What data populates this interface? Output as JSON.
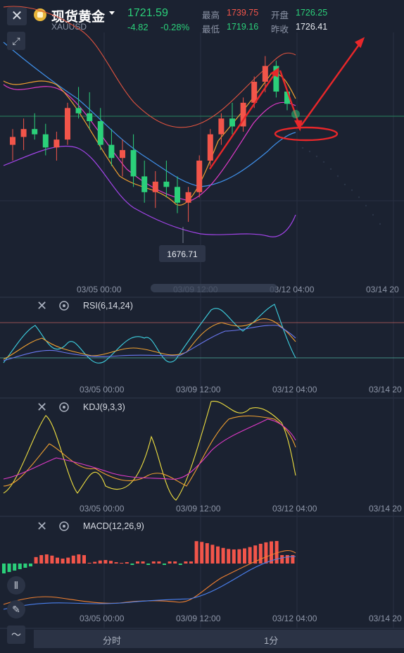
{
  "header": {
    "title": "现货黄金",
    "symbol": "XAUUSD",
    "price": "1721.59",
    "change": "-4.82",
    "change_pct": "-0.28%",
    "high_label": "最高",
    "high_value": "1739.75",
    "open_label": "开盘",
    "open_value": "1726.25",
    "low_label": "最低",
    "low_value": "1719.16",
    "prev_close_label": "昨收",
    "prev_close_value": "1726.41"
  },
  "main_chart": {
    "low_marker": "1676.71",
    "x_labels": [
      "03/05 00:00",
      "03/09 12:00",
      "03/12 04:00",
      "03/14 20"
    ]
  },
  "rsi_panel": {
    "label": "RSI(6,14,24)",
    "x_labels": [
      "03/05 00:00",
      "03/09 12:00",
      "03/12 04:00",
      "03/14 20"
    ]
  },
  "kdj_panel": {
    "label": "KDJ(9,3,3)",
    "x_labels": [
      "03/05 00:00",
      "03/09 12:00",
      "03/12 04:00",
      "03/14 20"
    ]
  },
  "macd_panel": {
    "label": "MACD(12,26,9)",
    "x_labels": [
      "03/05 00:00",
      "03/09 12:00",
      "03/12 04:00",
      "03/14 20"
    ]
  },
  "bottom_tabs": [
    "分时",
    "1分"
  ],
  "colors": {
    "up": "#f2554a",
    "down": "#2bd07a",
    "bg": "#1b2231"
  },
  "icons": [
    "close-icon",
    "gold-logo-icon",
    "dropdown-caret-icon",
    "expand-icon",
    "settings-icon",
    "indicator-icon",
    "draw-icon",
    "line-tool-icon"
  ],
  "chart_data": {
    "type": "candlestick",
    "ohlc": [
      [
        1706,
        1712,
        1700,
        1709
      ],
      [
        1709,
        1716,
        1704,
        1712
      ],
      [
        1712,
        1718,
        1708,
        1710
      ],
      [
        1710,
        1714,
        1702,
        1705
      ],
      [
        1705,
        1711,
        1700,
        1708
      ],
      [
        1708,
        1722,
        1706,
        1720
      ],
      [
        1720,
        1728,
        1716,
        1718
      ],
      [
        1718,
        1726,
        1712,
        1715
      ],
      [
        1715,
        1720,
        1704,
        1706
      ],
      [
        1706,
        1712,
        1698,
        1701
      ],
      [
        1701,
        1708,
        1694,
        1704
      ],
      [
        1704,
        1710,
        1690,
        1694
      ],
      [
        1694,
        1700,
        1684,
        1688
      ],
      [
        1688,
        1696,
        1682,
        1692
      ],
      [
        1692,
        1700,
        1686,
        1690
      ],
      [
        1690,
        1694,
        1680,
        1684
      ],
      [
        1684,
        1690,
        1676.71,
        1688
      ],
      [
        1688,
        1702,
        1686,
        1700
      ],
      [
        1700,
        1712,
        1698,
        1710
      ],
      [
        1710,
        1718,
        1706,
        1716
      ],
      [
        1716,
        1722,
        1710,
        1713
      ],
      [
        1713,
        1724,
        1711,
        1722
      ],
      [
        1722,
        1732,
        1720,
        1730
      ],
      [
        1730,
        1739.75,
        1726,
        1736
      ],
      [
        1736,
        1738,
        1724,
        1726.25
      ],
      [
        1726.25,
        1726.25,
        1719.16,
        1721.59
      ]
    ]
  }
}
